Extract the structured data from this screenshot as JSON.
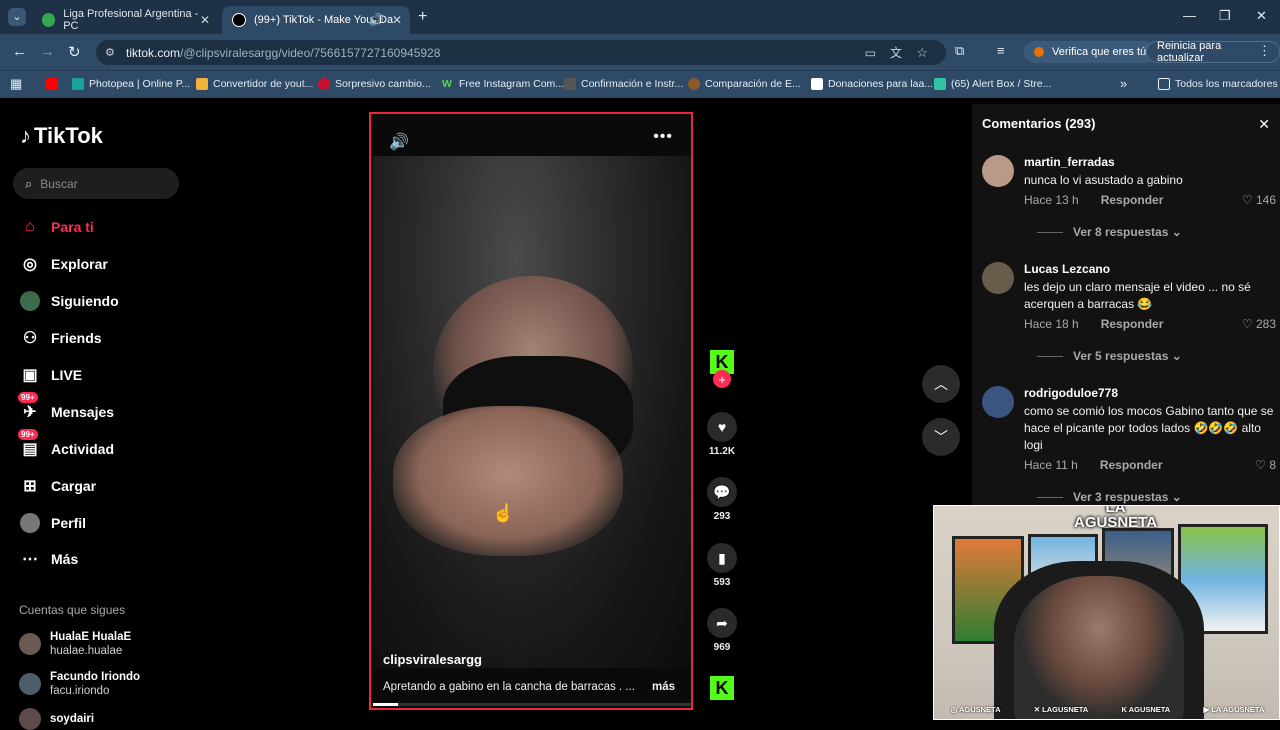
{
  "browser": {
    "tabs": [
      {
        "title": "Liga Profesional Argentina - PC",
        "active": false
      },
      {
        "title": "(99+) TikTok - Make Your Da",
        "active": true
      }
    ],
    "url_host": "tiktok.com",
    "url_path": "/@clipsviralesargg/video/7566157727160945928",
    "verify_label": "Verifica que eres tú",
    "restart_label": "Reinicia para actualizar",
    "bookmarks": [
      "Photopea | Online P...",
      "Convertidor de yout...",
      "Sorpresivo cambio...",
      "Free Instagram Com...",
      "Confirmación e Instr...",
      "Comparación de E...",
      "Donaciones para laa...",
      "(65) Alert Box / Stre..."
    ],
    "all_bookmarks": "Todos los marcadores",
    "more_bookmarks": "»"
  },
  "sidebar": {
    "logo": "TikTok",
    "search_placeholder": "Buscar",
    "items": [
      {
        "label": "Para ti",
        "icon": "home-icon",
        "active": true
      },
      {
        "label": "Explorar",
        "icon": "compass-icon"
      },
      {
        "label": "Siguiendo",
        "icon": "following-icon"
      },
      {
        "label": "Friends",
        "icon": "friends-icon"
      },
      {
        "label": "LIVE",
        "icon": "live-icon"
      },
      {
        "label": "Mensajes",
        "icon": "messages-icon",
        "badge": "99+"
      },
      {
        "label": "Actividad",
        "icon": "activity-icon",
        "badge": "99+"
      },
      {
        "label": "Cargar",
        "icon": "upload-icon"
      },
      {
        "label": "Perfil",
        "icon": "profile-icon"
      },
      {
        "label": "Más",
        "icon": "more-icon"
      }
    ],
    "following_title": "Cuentas que sigues",
    "following": [
      {
        "name": "HualaE HualaE",
        "handle": "hualae.hualae"
      },
      {
        "name": "Facundo Iriondo",
        "handle": "facu.iriondo"
      },
      {
        "name": "soydairi",
        "handle": ""
      }
    ]
  },
  "video": {
    "username": "clipsviralesargg",
    "caption": "Apretando a gabino en la cancha de barracas . ...",
    "more_label": "más",
    "progress_fraction": 0.08,
    "likes": "11.2K",
    "comments": "293",
    "saves": "593",
    "shares": "969"
  },
  "comments_panel": {
    "title": "Comentarios (293)",
    "reply_label": "Responder",
    "items": [
      {
        "user": "martin_ferradas",
        "text": "nunca lo vi asustado a gabino",
        "time": "Hace 13 h",
        "likes": "146",
        "replies": "Ver 8 respuestas"
      },
      {
        "user": "Lucas Lezcano",
        "text": "les dejo un claro mensaje el video ... no sé acerquen a barracas 😂",
        "time": "Hace 18 h",
        "likes": "283",
        "replies": "Ver 5 respuestas"
      },
      {
        "user": "rodrigoduloe778",
        "text": "como se comió los mocos Gabino tanto que se hace el picante por todos lados 🤣🤣🤣 alto logi",
        "time": "Hace 11 h",
        "likes": "8",
        "replies": "Ver 3 respuestas"
      }
    ]
  },
  "webcam": {
    "logo_line1": "LA",
    "logo_line2": "AGUSNETA",
    "socials": [
      "AGUSNETA",
      "LAGUSNETA",
      "AGUSNETA",
      "LA AGUSNETA"
    ]
  },
  "colors": {
    "accent": "#fe2c55",
    "kick": "#53fc18",
    "chrome_bg": "#2e4a66"
  }
}
